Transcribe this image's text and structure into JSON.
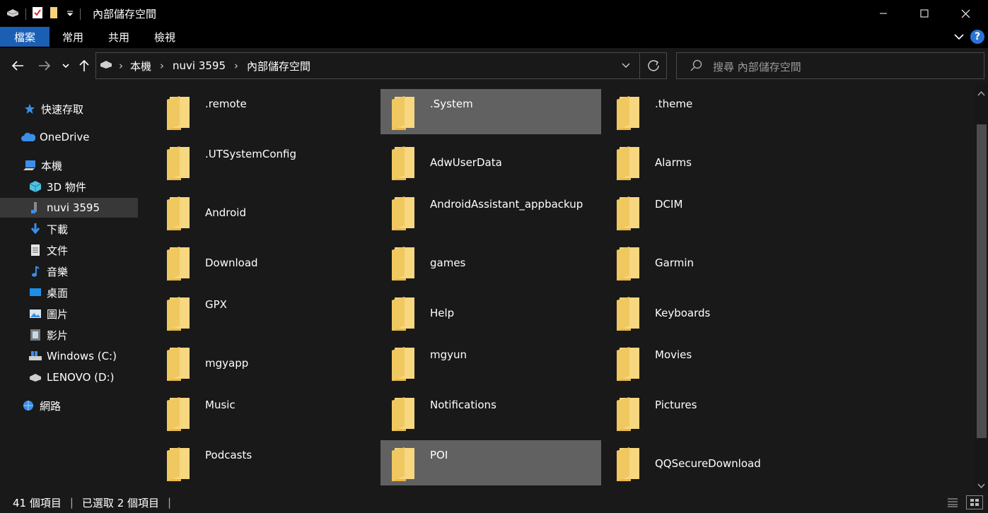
{
  "window": {
    "title": "內部儲存空間"
  },
  "ribbon": {
    "tabs": [
      "檔案",
      "常用",
      "共用",
      "檢視"
    ]
  },
  "address": {
    "crumbs": [
      "本機",
      "nuvi 3595",
      "內部儲存空間"
    ]
  },
  "search": {
    "placeholder": "搜尋 內部儲存空間"
  },
  "sidebar": {
    "items": [
      {
        "label": "快速存取",
        "icon": "star-icon"
      },
      {
        "label": "OneDrive",
        "icon": "cloud-icon"
      },
      {
        "label": "本機",
        "icon": "computer-icon"
      },
      {
        "label": "3D 物件",
        "icon": "cube-icon"
      },
      {
        "label": "nuvi 3595",
        "icon": "device-icon"
      },
      {
        "label": "下載",
        "icon": "download-icon"
      },
      {
        "label": "文件",
        "icon": "document-icon"
      },
      {
        "label": "音樂",
        "icon": "music-icon"
      },
      {
        "label": "桌面",
        "icon": "desktop-icon"
      },
      {
        "label": "圖片",
        "icon": "pictures-icon"
      },
      {
        "label": "影片",
        "icon": "videos-icon"
      },
      {
        "label": "Windows (C:)",
        "icon": "drive-icon"
      },
      {
        "label": "LENOVO (D:)",
        "icon": "drive-icon"
      },
      {
        "label": "網路",
        "icon": "network-icon"
      }
    ]
  },
  "folders": [
    {
      "name": ".remote",
      "selected": false
    },
    {
      "name": ".System",
      "selected": true
    },
    {
      "name": ".theme",
      "selected": false
    },
    {
      "name": ".UTSystemConfig",
      "selected": false
    },
    {
      "name": "AdwUserData",
      "selected": false
    },
    {
      "name": "Alarms",
      "selected": false
    },
    {
      "name": "Android",
      "selected": false
    },
    {
      "name": "AndroidAssistant_appbackup",
      "selected": false
    },
    {
      "name": "DCIM",
      "selected": false
    },
    {
      "name": "Download",
      "selected": false
    },
    {
      "name": "games",
      "selected": false
    },
    {
      "name": "Garmin",
      "selected": false
    },
    {
      "name": "GPX",
      "selected": false
    },
    {
      "name": "Help",
      "selected": false
    },
    {
      "name": "Keyboards",
      "selected": false
    },
    {
      "name": "mgyapp",
      "selected": false
    },
    {
      "name": "mgyun",
      "selected": false
    },
    {
      "name": "Movies",
      "selected": false
    },
    {
      "name": "Music",
      "selected": false
    },
    {
      "name": "Notifications",
      "selected": false
    },
    {
      "name": "Pictures",
      "selected": false
    },
    {
      "name": "Podcasts",
      "selected": false
    },
    {
      "name": "POI",
      "selected": true
    },
    {
      "name": "QQSecureDownload",
      "selected": false
    }
  ],
  "status": {
    "item_count": "41 個項目",
    "selected_count": "已選取 2 個項目"
  },
  "colors": {
    "accent": "#1a5fb4",
    "folder": "#f5d27b",
    "selected": "#616161"
  }
}
